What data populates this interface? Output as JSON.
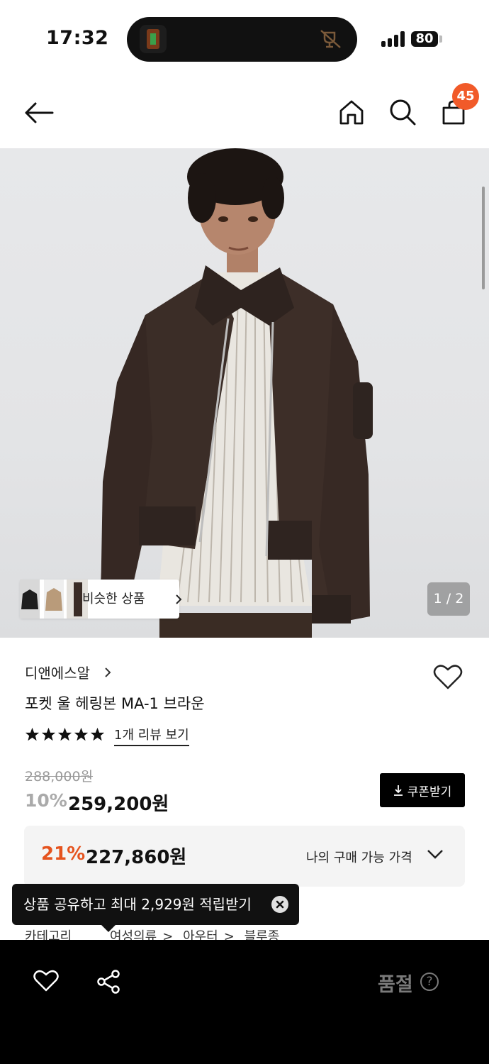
{
  "status_bar": {
    "time": "17:32",
    "battery": "80"
  },
  "header": {
    "cart_count": "45"
  },
  "gallery": {
    "similar_label": "비슷한 상품",
    "page_indicator": "1 / 2"
  },
  "product": {
    "brand": "디앤에스알",
    "name": "포켓 울 헤링본 MA-1 브라운",
    "rating_stars": 5,
    "review_link": "1개 리뷰 보기",
    "original_price": "288,000원",
    "discount": "10%",
    "price": "259,200원",
    "coupon_label": "쿠폰받기"
  },
  "my_price": {
    "percent": "21%",
    "price": "227,860원",
    "label": "나의 구매 가능 가격"
  },
  "tooltip": {
    "text": "상품 공유하고 최대 2,929원 적립받기"
  },
  "category": {
    "label": "카테고리",
    "path": [
      "여성의류",
      "아우터",
      "블루종"
    ]
  },
  "bottom_bar": {
    "status": "품절",
    "help": "?"
  },
  "colors": {
    "accent": "#f15a29",
    "discount_orange": "#e5531e"
  }
}
